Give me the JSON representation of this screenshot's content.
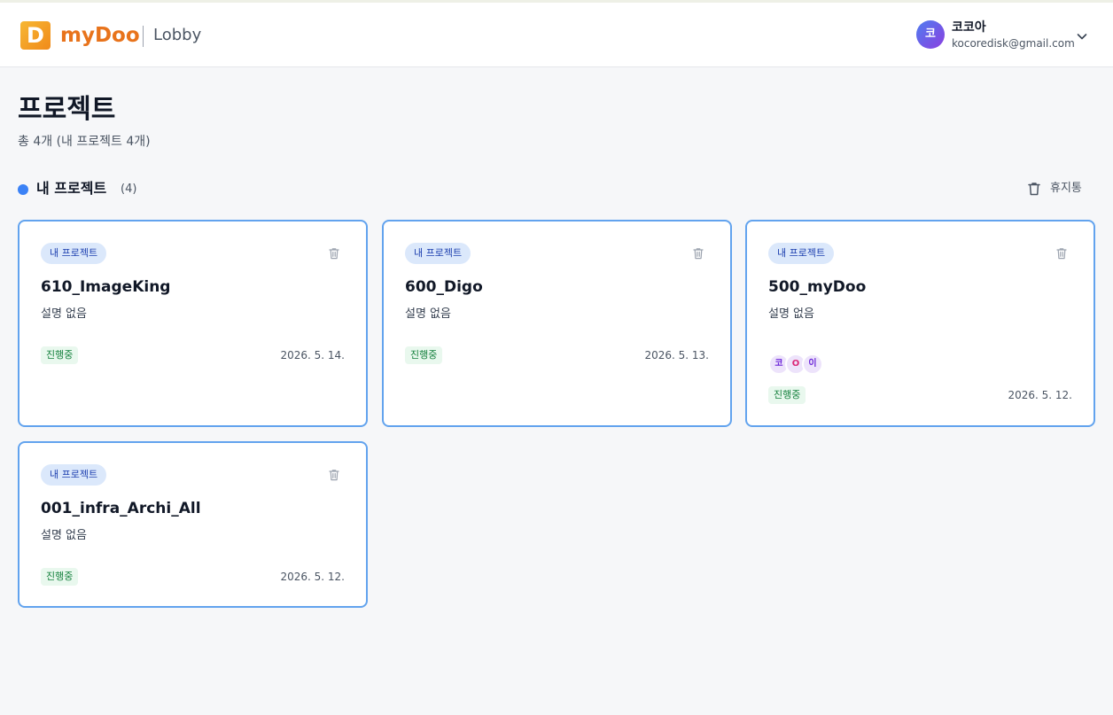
{
  "header": {
    "logo_letter": "D",
    "brand": "myDoo",
    "breadcrumb": "Lobby",
    "user": {
      "avatar_initial": "코",
      "name": "코코아",
      "email": "kocoredisk@gmail.com"
    }
  },
  "page": {
    "title": "프로젝트",
    "subtitle": "총 4개 (내 프로젝트 4개)"
  },
  "section": {
    "title": "내 프로젝트",
    "count": "(4)",
    "trash_label": "휴지통"
  },
  "projects": [
    {
      "tag": "내 프로젝트",
      "name": "610_ImageKing",
      "description": "설명 없음",
      "status": "진행중",
      "date": "2026. 5. 14."
    },
    {
      "tag": "내 프로젝트",
      "name": "600_Digo",
      "description": "설명 없음",
      "status": "진행중",
      "date": "2026. 5. 13."
    },
    {
      "tag": "내 프로젝트",
      "name": "500_myDoo",
      "description": "설명 없음",
      "status": "진행중",
      "date": "2026. 5. 12.",
      "members": [
        "코",
        "O",
        "이"
      ]
    },
    {
      "tag": "내 프로젝트",
      "name": "001_infra_Archi_All",
      "description": "설명 없음",
      "status": "진행중",
      "date": "2026. 5. 12."
    }
  ],
  "colors": {
    "brand": "#e8731b",
    "card_border": "#62a3ee",
    "section_dot": "#3b82f6",
    "status_text": "#15803d"
  }
}
